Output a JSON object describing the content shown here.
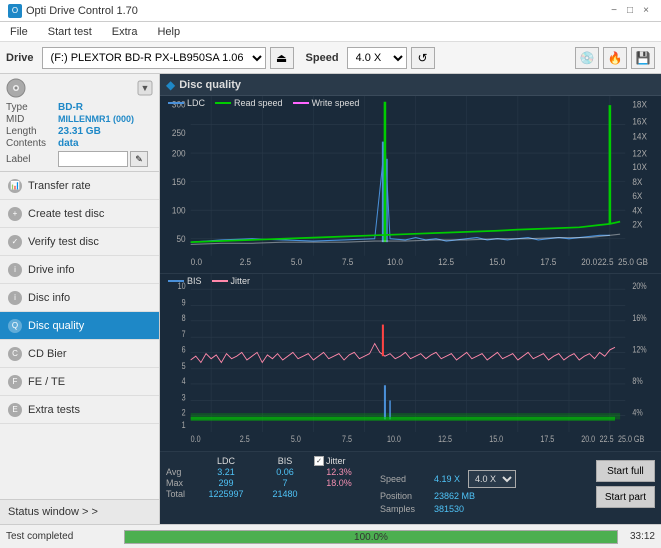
{
  "titlebar": {
    "title": "Opti Drive Control 1.70",
    "icon": "O",
    "min": "−",
    "max": "□",
    "close": "×"
  },
  "menubar": {
    "items": [
      "File",
      "Start test",
      "Extra",
      "Help"
    ]
  },
  "drivetoolbar": {
    "drive_label": "Drive",
    "drive_value": "(F:) PLEXTOR BD-R  PX-LB950SA 1.06",
    "speed_label": "Speed",
    "speed_value": "4.0 X"
  },
  "disc": {
    "type_label": "Type",
    "type_value": "BD-R",
    "mid_label": "MID",
    "mid_value": "MILLENMR1 (000)",
    "length_label": "Length",
    "length_value": "23.31 GB",
    "contents_label": "Contents",
    "contents_value": "data",
    "label_label": "Label"
  },
  "nav": {
    "items": [
      {
        "id": "transfer-rate",
        "label": "Transfer rate",
        "active": false
      },
      {
        "id": "create-test-disc",
        "label": "Create test disc",
        "active": false
      },
      {
        "id": "verify-test-disc",
        "label": "Verify test disc",
        "active": false
      },
      {
        "id": "drive-info",
        "label": "Drive info",
        "active": false
      },
      {
        "id": "disc-info",
        "label": "Disc info",
        "active": false
      },
      {
        "id": "disc-quality",
        "label": "Disc quality",
        "active": true
      },
      {
        "id": "cd-bier",
        "label": "CD Bier",
        "active": false
      },
      {
        "id": "fe-te",
        "label": "FE / TE",
        "active": false
      },
      {
        "id": "extra-tests",
        "label": "Extra tests",
        "active": false
      }
    ],
    "status_window": "Status window > >"
  },
  "disc_quality": {
    "title": "Disc quality",
    "legend": {
      "ldc_label": "LDC",
      "read_label": "Read speed",
      "write_label": "Write speed"
    },
    "legend2": {
      "bis_label": "BIS",
      "jitter_label": "Jitter"
    }
  },
  "stats": {
    "col_headers": [
      "LDC",
      "BIS"
    ],
    "jitter_label": "Jitter",
    "jitter_checked": true,
    "rows": [
      {
        "label": "Avg",
        "ldc": "3.21",
        "bis": "0.06",
        "jitter": "12.3%"
      },
      {
        "label": "Max",
        "ldc": "299",
        "bis": "7",
        "jitter": "18.0%"
      },
      {
        "label": "Total",
        "ldc": "1225997",
        "bis": "21480",
        "jitter": ""
      }
    ],
    "speed_label": "Speed",
    "speed_value": "4.19 X",
    "speed_select": "4.0 X",
    "position_label": "Position",
    "position_value": "23862 MB",
    "samples_label": "Samples",
    "samples_value": "381530",
    "start_full_btn": "Start full",
    "start_part_btn": "Start part"
  },
  "statusbar": {
    "status_text": "Test completed",
    "progress": 100,
    "progress_label": "100.0%",
    "time": "33:12"
  }
}
